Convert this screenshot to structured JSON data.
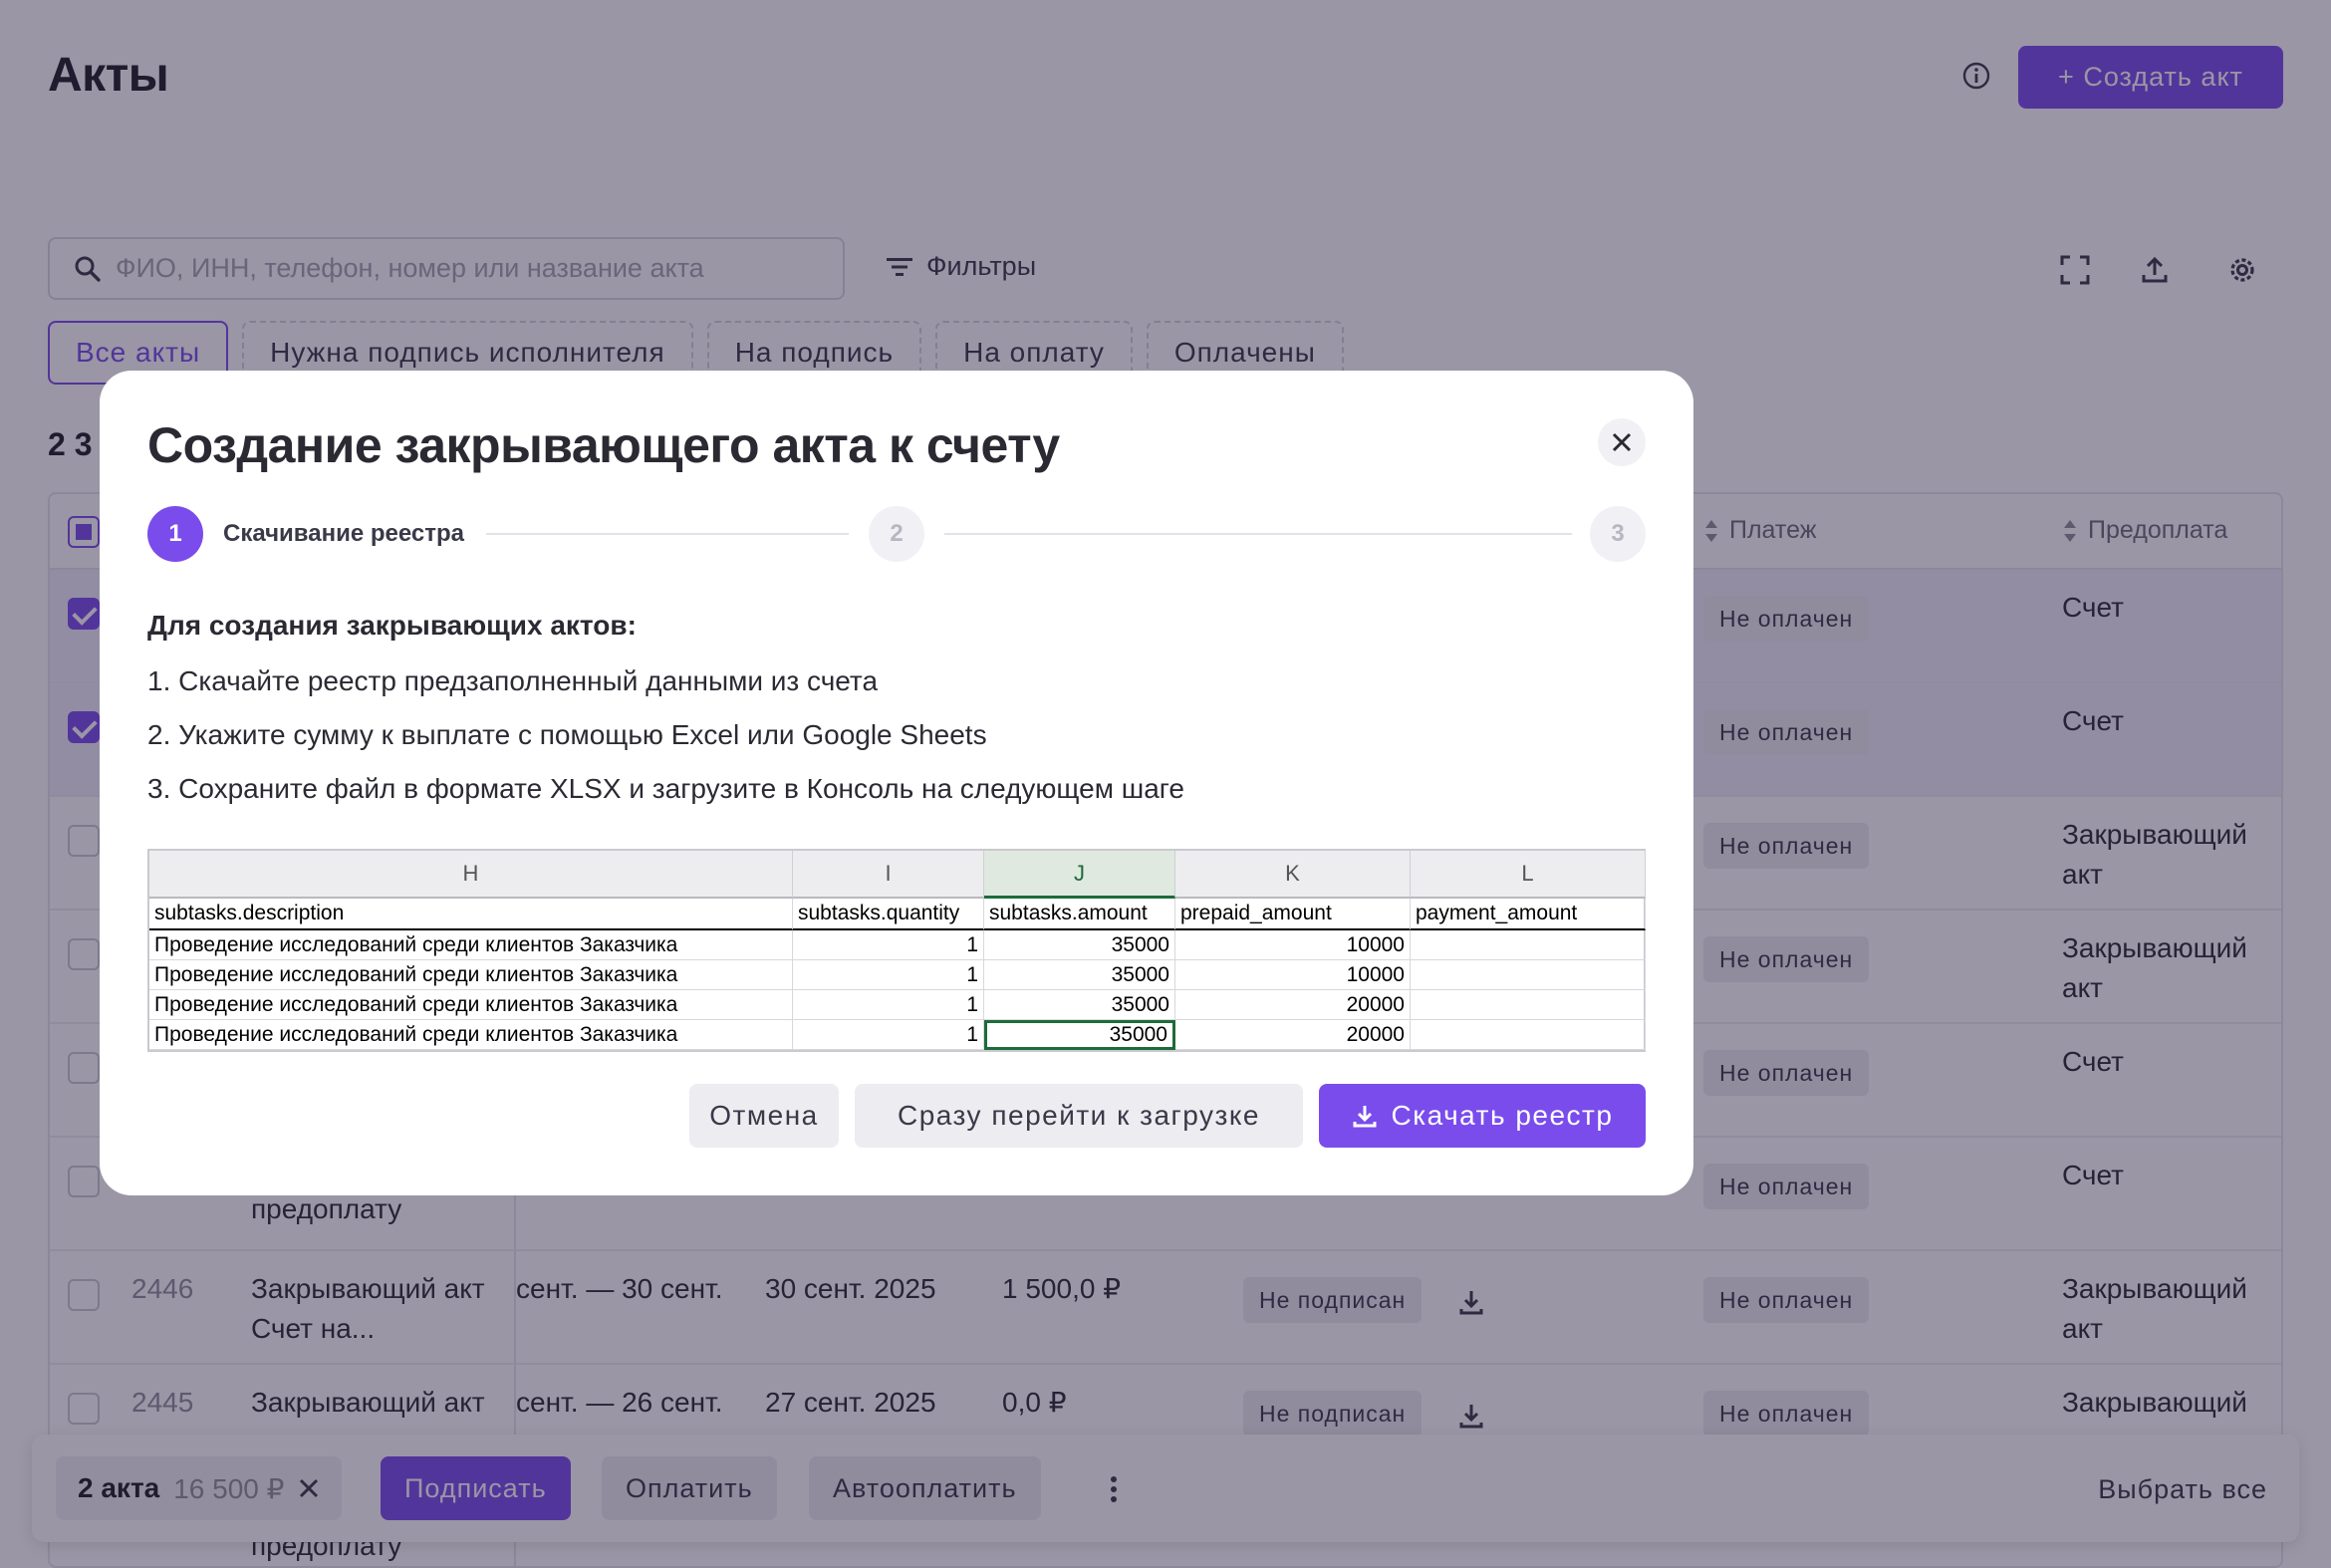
{
  "page": {
    "title": "Акты",
    "create_button": "+ Создать акт",
    "search_placeholder": "ФИО, ИНН, телефон, номер или название акта",
    "filters_label": "Фильтры",
    "tabs": [
      {
        "label": "Все акты",
        "active": true
      },
      {
        "label": "Нужна подпись исполнителя",
        "active": false
      },
      {
        "label": "На подпись",
        "active": false
      },
      {
        "label": "На оплату",
        "active": false
      },
      {
        "label": "Оплачены",
        "active": false
      }
    ],
    "count_partial": "2 3",
    "columns": {
      "payment": "Платеж",
      "prepayment": "Предоплата"
    },
    "rows": [
      {
        "payment_status": "Не оплачен",
        "prepayment": "Счет"
      },
      {
        "payment_status": "Не оплачен",
        "prepayment": "Счет"
      },
      {
        "payment_status": "Не оплачен",
        "prepayment": "Закрывающий акт"
      },
      {
        "payment_status": "Не оплачен",
        "prepayment": "Закрывающий акт"
      },
      {
        "payment_status": "Не оплачен",
        "prepayment": "Счет"
      },
      {
        "payment_status": "Не оплачен",
        "prepayment": "Счет",
        "name_tail": "предоплату"
      },
      {
        "id": "2446",
        "name": "Закрывающий акт Счет на...",
        "period": "сент. — 30 сент.",
        "date": "30 сент. 2025",
        "amount": "1 500,0 ₽",
        "sign_status": "Не подписан",
        "payment_status": "Не оплачен",
        "prepayment": "Закрывающий акт"
      },
      {
        "id": "2445",
        "name": "Закрывающий акт",
        "period": "сент. — 26 сент.",
        "date": "27 сент. 2025",
        "amount": "0,0 ₽",
        "sign_status": "Не подписан",
        "payment_status": "Не оплачен",
        "prepayment": "Закрывающий"
      }
    ],
    "bottom_tail": "предоплату"
  },
  "bulkbar": {
    "selected_count": "2 акта",
    "selected_sum": "16 500 ₽",
    "sign": "Подписать",
    "pay": "Оплатить",
    "autopay": "Автооплатить",
    "select_all": "Выбрать все"
  },
  "modal": {
    "title": "Создание закрывающего акта к счету",
    "steps": [
      {
        "number": "1",
        "label": "Скачивание реестра",
        "active": true
      },
      {
        "number": "2",
        "active": false
      },
      {
        "number": "3",
        "active": false
      }
    ],
    "instructions_heading": "Для создания закрывающих актов:",
    "instructions": [
      "1. Скачайте реестр предзаполненный данными из счета",
      "2. Укажите сумму к выплате с помощью Excel или Google Sheets",
      "3. Сохраните файл в формате XLSX и загрузите в Консоль на следующем шаге"
    ],
    "sheet": {
      "column_letters": [
        "H",
        "I",
        "J",
        "K",
        "L"
      ],
      "selected_column": "J",
      "headers": [
        "subtasks.description",
        "subtasks.quantity",
        "subtasks.amount",
        "prepaid_amount",
        "payment_amount"
      ],
      "rows": [
        [
          "Проведение исследований среди клиентов Заказчика",
          "1",
          "35000",
          "10000",
          ""
        ],
        [
          "Проведение исследований среди клиентов Заказчика",
          "1",
          "35000",
          "10000",
          ""
        ],
        [
          "Проведение исследований среди клиентов Заказчика",
          "1",
          "35000",
          "20000",
          ""
        ],
        [
          "Проведение исследований среди клиентов Заказчика",
          "1",
          "35000",
          "20000",
          ""
        ]
      ]
    },
    "buttons": {
      "cancel": "Отмена",
      "skip": "Сразу перейти к загрузке",
      "download": "Скачать реестр"
    }
  },
  "colors": {
    "accent": "#7a4cec",
    "overlay": "rgba(35,26,58,0.46)"
  }
}
